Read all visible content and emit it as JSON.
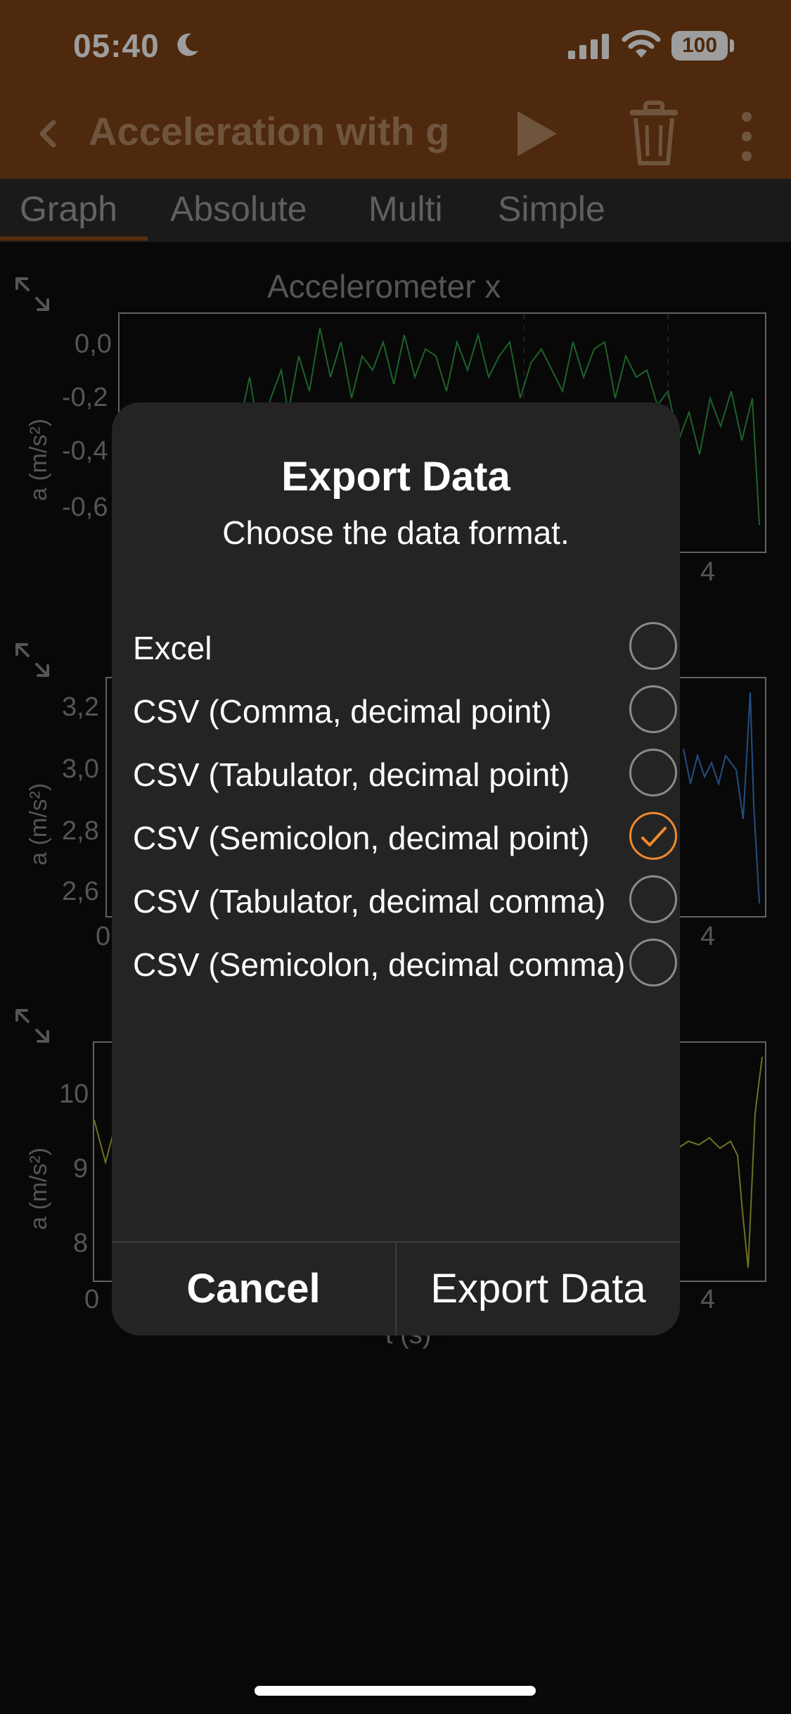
{
  "status_bar": {
    "time": "05:40",
    "battery": "100"
  },
  "app_bar": {
    "title": "Acceleration with g"
  },
  "tabs": [
    "Graph",
    "Absolute",
    "Multi",
    "Simple"
  ],
  "charts": [
    {
      "title": "Accelerometer x",
      "ylabel": "a (m/s²)",
      "yticks": [
        "0,0",
        "-0,2",
        "-0,4",
        "-0,6"
      ],
      "xticks": [
        "4"
      ],
      "series_color": "#2ea043"
    },
    {
      "ylabel": "a (m/s²)",
      "yticks": [
        "3,2",
        "3,0",
        "2,8",
        "2,6"
      ],
      "xticks": [
        "0",
        "4"
      ],
      "series_color": "#3b7fd1"
    },
    {
      "ylabel": "a (m/s²)",
      "yticks": [
        "10",
        "9",
        "8"
      ],
      "xticks": [
        "0",
        "4"
      ],
      "xlabel": "t (s)",
      "series_color": "#b5b53a"
    }
  ],
  "dialog": {
    "title": "Export Data",
    "subtitle": "Choose the data format.",
    "options": [
      {
        "label": "Excel",
        "selected": false
      },
      {
        "label": "CSV (Comma, decimal point)",
        "selected": false
      },
      {
        "label": "CSV (Tabulator, decimal point)",
        "selected": false
      },
      {
        "label": "CSV (Semicolon, decimal point)",
        "selected": true
      },
      {
        "label": "CSV (Tabulator, decimal comma)",
        "selected": false
      },
      {
        "label": "CSV (Semicolon, decimal comma)",
        "selected": false
      }
    ],
    "cancel": "Cancel",
    "export": "Export Data"
  },
  "colors": {
    "appbar": "#7f4315",
    "accent": "#f08a2c"
  }
}
